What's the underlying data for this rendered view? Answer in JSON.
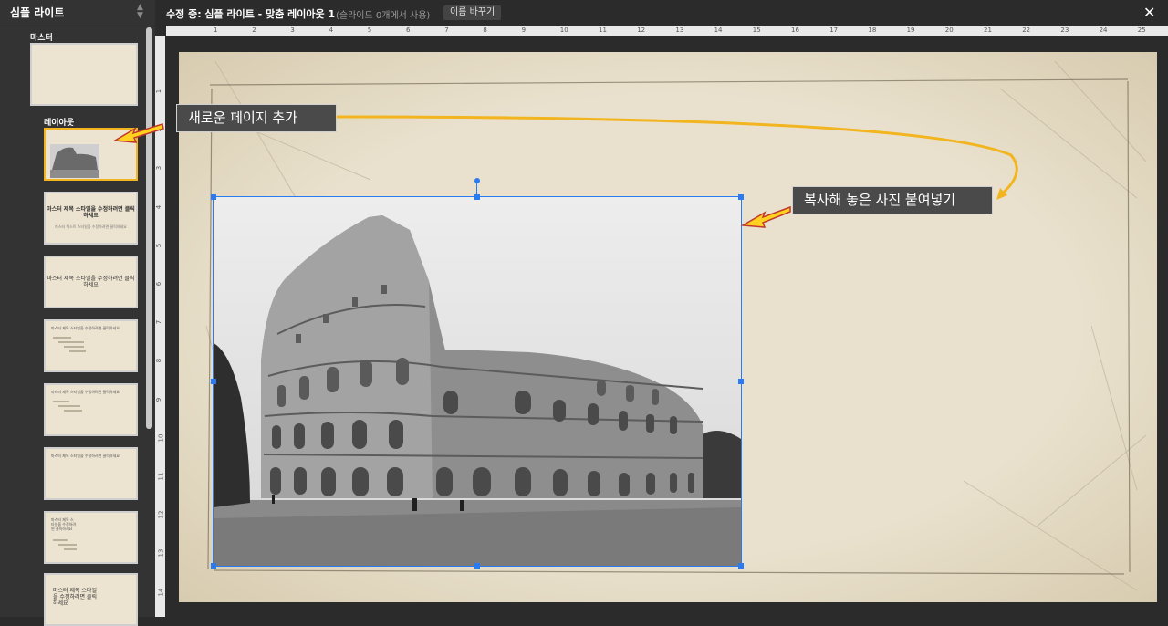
{
  "left_panel": {
    "title": "심플 라이트",
    "sort_icon": "sort-updown-icon",
    "master_label": "마스터",
    "layout_label": "레이아웃",
    "thumbnails": [
      {
        "text": "마스터 제목 스타일을 수정하려면 클릭하세요",
        "sub": "마스터 텍스트 스타일을 수정하려면 클릭하세요"
      },
      {
        "text": "마스터 제목 스타일을 수정하려면 클릭하세요"
      },
      {
        "text": "마스터 제목 스타일을 수정하려면 클릭하세요"
      },
      {
        "text": "마스터 제목 스타일을 수정하려면 클릭하세요"
      },
      {
        "text": "마스터 제목 스타일을 수정하려면 클릭하세요"
      },
      {
        "text": "마스터 제목 스타일을 수정하려면 클릭하세요"
      },
      {
        "text": "마스터 제목 스타일을 수정하려면 클릭하세요"
      }
    ]
  },
  "top_bar": {
    "editing_title": "수정 중: 심플 라이트 - 맞춤 레이아웃 1",
    "usage_note": "(슬라이드 0개에서 사용)",
    "rename_button": "이름 바꾸기",
    "close_icon": "close-icon",
    "close_glyph": "✕"
  },
  "rulers": {
    "top_ticks": [
      "1",
      "2",
      "3",
      "4",
      "5",
      "6",
      "7",
      "8",
      "9",
      "10",
      "11",
      "12",
      "13",
      "14",
      "15",
      "16",
      "17",
      "18",
      "19",
      "20",
      "21",
      "22",
      "23",
      "24",
      "25"
    ],
    "left_ticks": [
      "1",
      "2",
      "3",
      "4",
      "5",
      "6",
      "7",
      "8",
      "9",
      "10",
      "11",
      "12",
      "13",
      "14"
    ]
  },
  "callouts": {
    "new_page": "새로운 페이지 추가",
    "paste_photo": "복사해 놓은 사진 붙여넣기"
  },
  "colors": {
    "accent_selection": "#2a7bf2",
    "annotation_arrow": "#f2b51f",
    "selected_thumb_border": "#f2b51f",
    "slide_background": "#e8e0cc"
  }
}
